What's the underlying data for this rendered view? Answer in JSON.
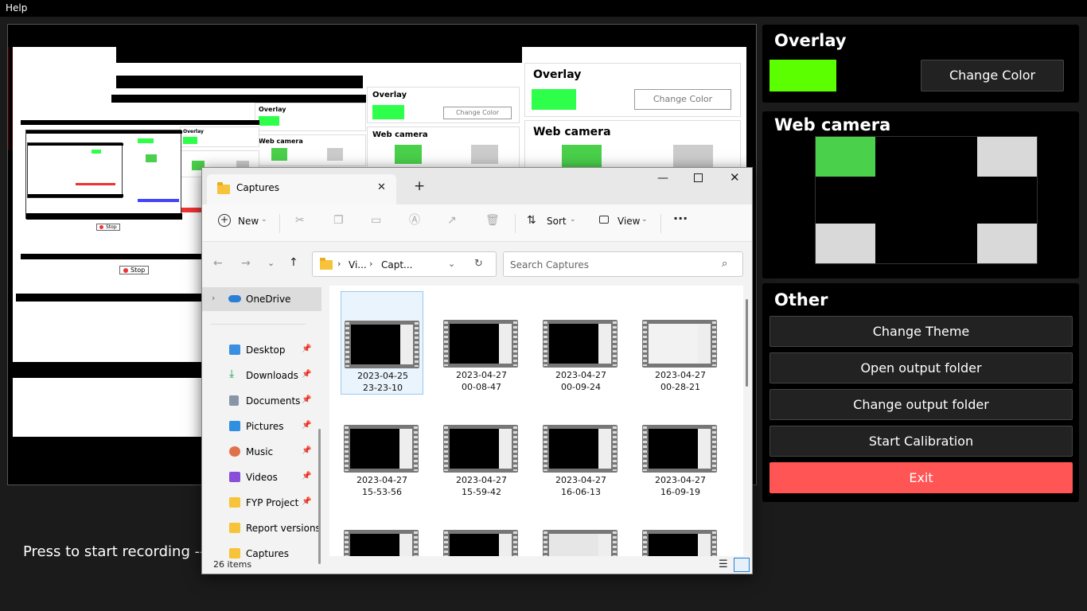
{
  "menu": {
    "help": "Help"
  },
  "preview": {
    "record_label": "Press to start recording --"
  },
  "overlay": {
    "title": "Overlay",
    "color": "#5cff00",
    "change_color": "Change Color"
  },
  "webcam": {
    "title": "Web camera"
  },
  "other": {
    "title": "Other",
    "change_theme": "Change Theme",
    "open_output": "Open output folder",
    "change_output": "Change output folder",
    "start_calibration": "Start Calibration",
    "exit": "Exit"
  },
  "explorer": {
    "tab_title": "Captures",
    "toolbar": {
      "new": "New",
      "sort": "Sort",
      "view": "View"
    },
    "breadcrumb": [
      "Vi...",
      "Capt..."
    ],
    "search_placeholder": "Search Captures",
    "nav": {
      "onedrive": "OneDrive",
      "items": [
        "Desktop",
        "Downloads",
        "Documents",
        "Pictures",
        "Music",
        "Videos",
        "FYP Project",
        "Report versions",
        "Captures"
      ]
    },
    "files": [
      {
        "date": "2023-04-25",
        "time": "23-23-10"
      },
      {
        "date": "2023-04-27",
        "time": "00-08-47"
      },
      {
        "date": "2023-04-27",
        "time": "00-09-24"
      },
      {
        "date": "2023-04-27",
        "time": "00-28-21"
      },
      {
        "date": "2023-04-27",
        "time": "15-53-56"
      },
      {
        "date": "2023-04-27",
        "time": "15-59-42"
      },
      {
        "date": "2023-04-27",
        "time": "16-06-13"
      },
      {
        "date": "2023-04-27",
        "time": "16-09-19"
      }
    ],
    "status": "26 items"
  }
}
